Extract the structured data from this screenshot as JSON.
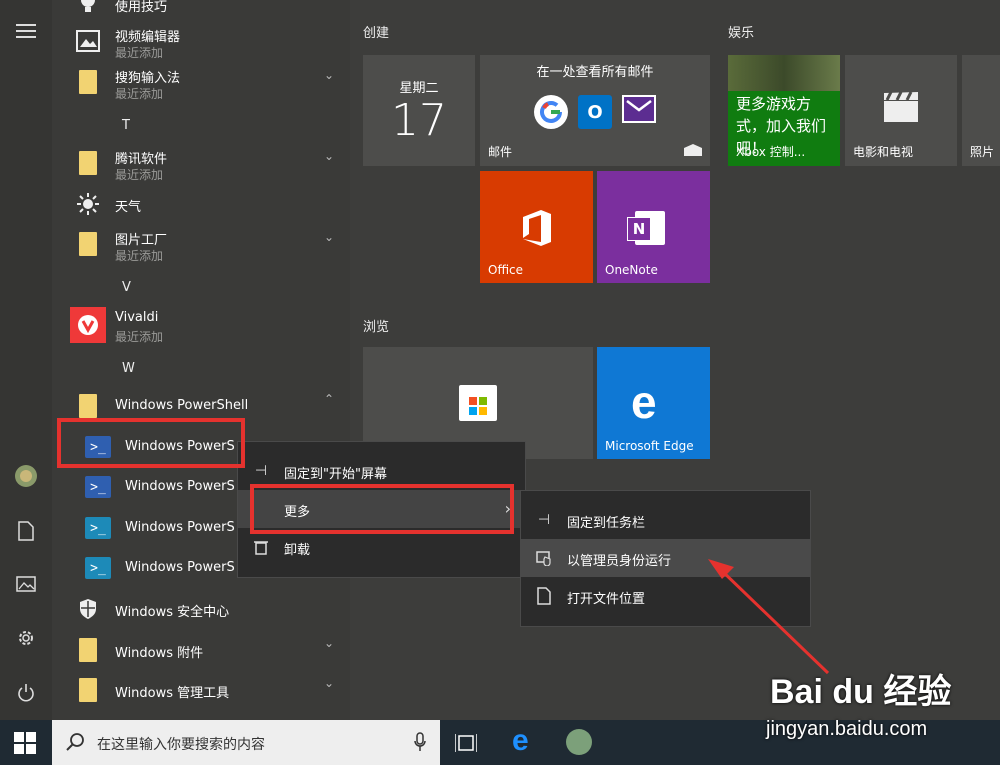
{
  "applist": {
    "items": [
      {
        "name": "使用技巧",
        "sub": "",
        "icon": "lightbulb-icon"
      },
      {
        "name": "视频编辑器",
        "sub": "最近添加",
        "icon": "video-editor-icon"
      },
      {
        "name": "搜狗输入法",
        "sub": "最近添加",
        "icon": "folder-icon"
      },
      {
        "name": "腾讯软件",
        "sub": "最近添加",
        "icon": "folder-icon"
      },
      {
        "name": "天气",
        "sub": "",
        "icon": "sun-icon"
      },
      {
        "name": "图片工厂",
        "sub": "最近添加",
        "icon": "folder-icon"
      },
      {
        "name": "Vivaldi",
        "sub": "最近添加",
        "icon": "vivaldi-icon"
      },
      {
        "name": "Windows PowerShell",
        "sub": "",
        "icon": "folder-icon"
      },
      {
        "name": "Windows PowerS",
        "sub": "",
        "icon": "powershell-icon"
      },
      {
        "name": "Windows PowerS",
        "sub": "",
        "icon": "powershell-icon"
      },
      {
        "name": "Windows PowerS",
        "sub": "",
        "icon": "powershell-ise-icon"
      },
      {
        "name": "Windows PowerS",
        "sub": "",
        "icon": "powershell-ise-icon"
      },
      {
        "name": "Windows 安全中心",
        "sub": "",
        "icon": "shield-icon"
      },
      {
        "name": "Windows 附件",
        "sub": "",
        "icon": "folder-icon"
      },
      {
        "name": "Windows 管理工具",
        "sub": "",
        "icon": "folder-icon"
      }
    ],
    "letters": [
      "T",
      "V",
      "W"
    ]
  },
  "groups": {
    "create": "创建",
    "entertainment": "娱乐",
    "browse": "浏览"
  },
  "tiles": {
    "calendar_day": "星期二",
    "calendar_date": "17",
    "mail_header": "在一处查看所有邮件",
    "mail_label": "邮件",
    "xbox_text": "更多游戏方式，加入我们吧！",
    "xbox_label": "Xbox 控制...",
    "movies_label": "电影和电视",
    "photos_label": "照片",
    "office_label": "Office",
    "onenote_label": "OneNote",
    "edge_label": "Microsoft Edge"
  },
  "context_menu": {
    "items": [
      {
        "label": "固定到\"开始\"屏幕",
        "icon": "pin-icon"
      },
      {
        "label": "更多",
        "icon": ""
      },
      {
        "label": "卸载",
        "icon": "trash-icon"
      }
    ]
  },
  "submenu": {
    "items": [
      {
        "label": "固定到任务栏",
        "icon": "pin-icon"
      },
      {
        "label": "以管理员身份运行",
        "icon": "admin-shield-icon"
      },
      {
        "label": "打开文件位置",
        "icon": "file-icon"
      }
    ]
  },
  "taskbar": {
    "search_placeholder": "在这里输入你要搜索的内容"
  },
  "watermark": {
    "brand": "Bai du 经验",
    "url": "jingyan.baidu.com"
  },
  "colors": {
    "office": "#d83b01",
    "onenote": "#7b2f9e",
    "edge": "#0f78d4",
    "xbox": "#107c10",
    "highlight": "#e5322e"
  }
}
